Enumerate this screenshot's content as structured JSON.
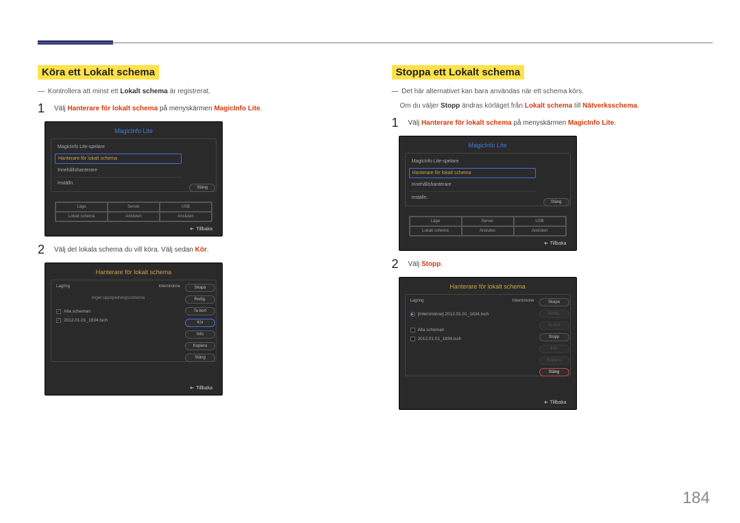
{
  "page_number": "184",
  "left": {
    "heading": "Köra ett Lokalt schema",
    "note_prefix": "―",
    "note_a": "Kontrollera att minst ett ",
    "note_bold": "Lokalt schema",
    "note_c": " är registrerat.",
    "step1_num": "1",
    "step1_a": "Välj ",
    "step1_b": "Hanterare för lokalt schema",
    "step1_c": " på menyskärmen ",
    "step1_d": "MagicInfo Lite",
    "step1_e": ".",
    "screen1": {
      "title": "MagicInfo Lite",
      "m1": "MagicInfo Lite-spelare",
      "m2": "Hanterare för lokalt schema",
      "m3": "Innehållshanterare",
      "m4": "Inställn.",
      "side": "Stäng",
      "grid": [
        "Läge",
        "Server",
        "USB",
        "Lokalt schema",
        "Ansluten",
        "Ansluten"
      ],
      "back": "Tillbaka"
    },
    "step2_num": "2",
    "step2_a": "Välj det lokala schema du vill köra. Välj sedan ",
    "step2_b": "Kör",
    "step2_c": ".",
    "screen2": {
      "title": "Hanterare för lokalt schema",
      "head_l": "Lagring",
      "head_r": "Internminne",
      "msg": "Inget uppspelningsschema",
      "chk_all": "Alla scheman",
      "item1": "2012.01.01_1834.lsch",
      "btns": [
        "Skapa",
        "Redig.",
        "Ta bort",
        "Kör",
        "Info",
        "Kopiera",
        "Stäng"
      ],
      "emph": 3,
      "back": "Tillbaka"
    }
  },
  "right": {
    "heading": "Stoppa ett Lokalt schema",
    "note1_prefix": "―",
    "note1": "Det här alternativet kan bara användas när ett schema körs.",
    "note2_a": "Om du väljer ",
    "note2_b": "Stopp",
    "note2_c": " ändras körläget från ",
    "note2_d": "Lokalt schema",
    "note2_e": " till ",
    "note2_f": "Nätverksschema",
    "note2_g": ".",
    "step1_num": "1",
    "step1_a": "Välj ",
    "step1_b": "Hanterare för lokalt schema",
    "step1_c": " på menyskärmen ",
    "step1_d": "MagicInfo Lite",
    "step1_e": ".",
    "screen1": {
      "title": "MagicInfo Lite",
      "m1": "MagicInfo Lite-spelare",
      "m2": "Hanterare för lokalt schema",
      "m3": "Innehållshanterare",
      "m4": "Inställn.",
      "side": "Stäng",
      "grid": [
        "Läge",
        "Server",
        "USB",
        "Lokalt schema",
        "Ansluten",
        "Ansluten"
      ],
      "back": "Tillbaka"
    },
    "step2_num": "2",
    "step2_a": "Välj ",
    "step2_b": "Stopp",
    "step2_c": ".",
    "screen2": {
      "title": "Hanterare för lokalt schema",
      "head_l": "Lagring",
      "head_r": "Internminne",
      "playing": "[Internminne] 2012.01.01_1834.lsch",
      "chk_all": "Alla scheman",
      "item1": "2012.01.01_1834.lsch",
      "btns": [
        "Skapa",
        "Redig.",
        "Ta bort",
        "Stopp",
        "Info",
        "Kopiera",
        "Stäng"
      ],
      "emph_red": 6,
      "back": "Tillbaka"
    }
  }
}
